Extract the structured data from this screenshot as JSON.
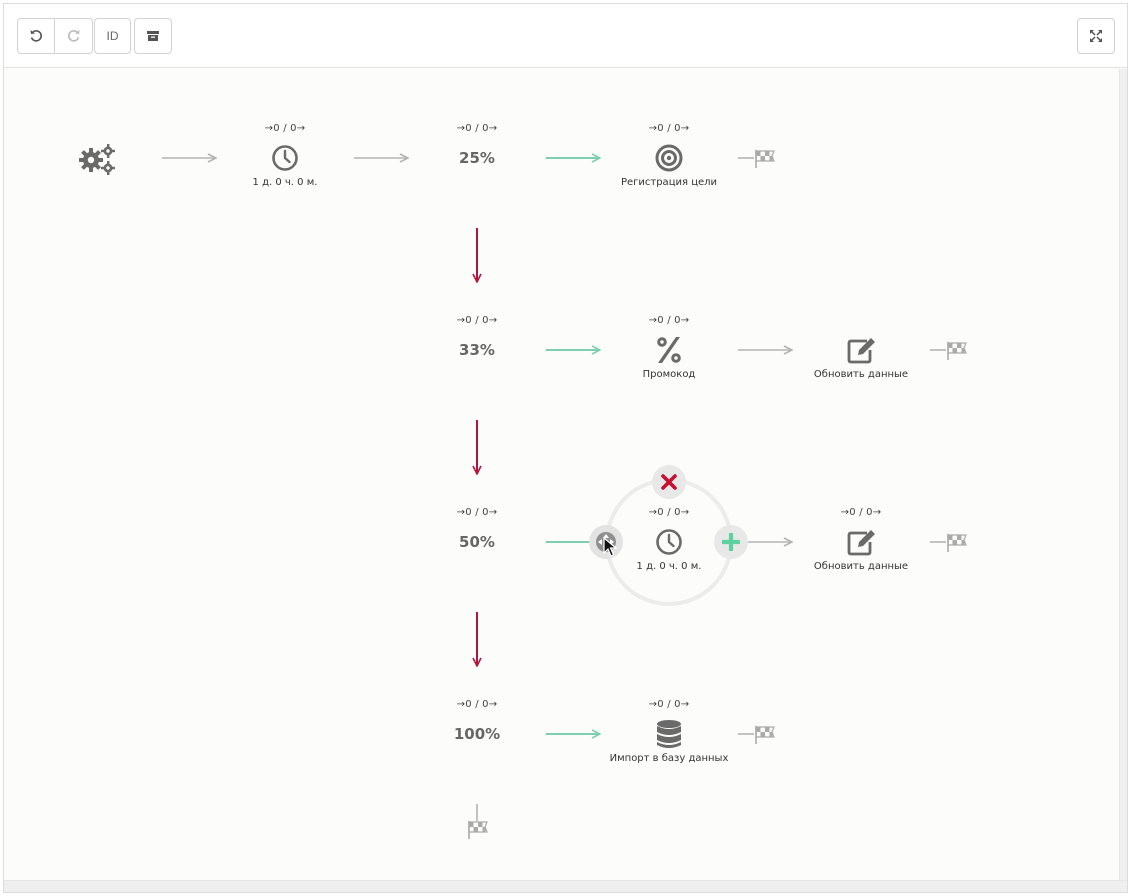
{
  "toolbar": {
    "undo_icon": "undo-icon",
    "redo_icon": "redo-icon",
    "id_label": "ID",
    "archive_icon": "archive-icon",
    "expand_icon": "expand-icon"
  },
  "colors": {
    "green_arrow": "#7ecfb0",
    "gray_arrow": "#b3b3b3",
    "red_arrow": "#b5153a",
    "icon": "#6a6a6a",
    "delete": "#c8102e",
    "add": "#5fd0a0"
  },
  "stats": {
    "timer1": "0 / 0",
    "split1": "0 / 0",
    "goal": "0 / 0",
    "split2": "0 / 0",
    "promo": "0 / 0",
    "split3": "0 / 0",
    "timer2": "0 / 0",
    "update2": "0 / 0",
    "split4": "0 / 0",
    "import": "0 / 0"
  },
  "nodes": {
    "timer1_label": "1 д. 0 ч. 0 м.",
    "split1_pct": "25%",
    "goal_label": "Регистрация цели",
    "split2_pct": "33%",
    "promo_label": "Промокод",
    "update1_label": "Обновить данные",
    "split3_pct": "50%",
    "timer2_label": "1 д. 0 ч. 0 м.",
    "update2_label": "Обновить данные",
    "split4_pct": "100%",
    "import_label": "Импорт в базу данных"
  }
}
